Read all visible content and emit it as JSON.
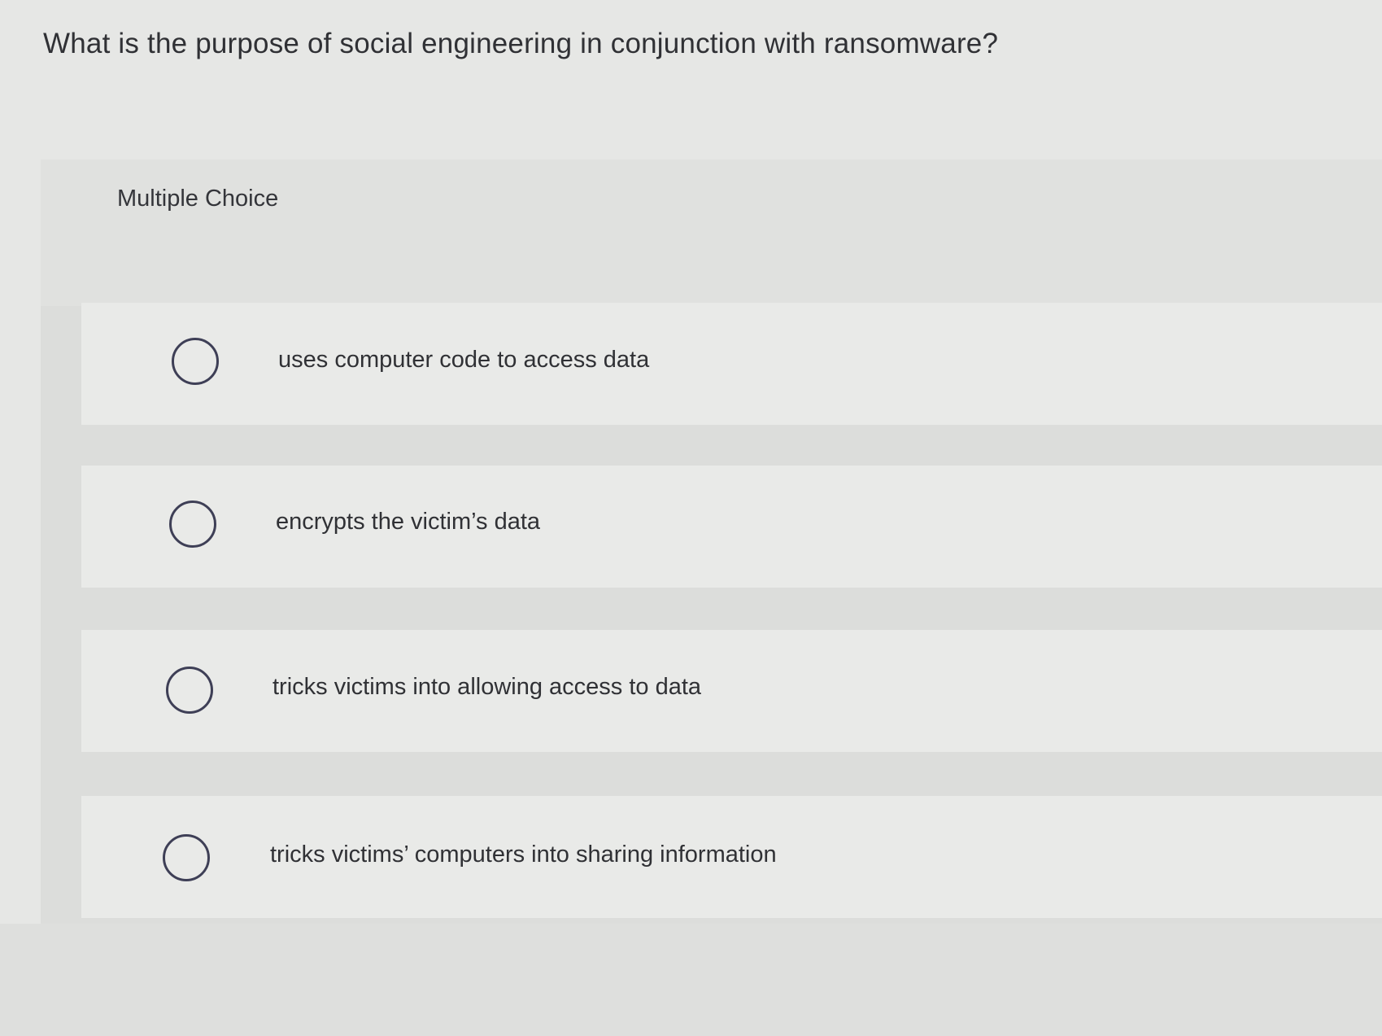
{
  "question": "What is the purpose of social engineering in conjunction with ransomware?",
  "section_label": "Multiple Choice",
  "options": [
    {
      "label": "uses computer code to access data",
      "selected": false
    },
    {
      "label": "encrypts the victim’s data",
      "selected": false
    },
    {
      "label": "tricks victims into allowing access to data",
      "selected": false
    },
    {
      "label": "tricks victims’ computers into sharing information",
      "selected": false
    }
  ],
  "colors": {
    "background": "#e6e7e5",
    "option_row": "#e9eae8",
    "radio_border": "#3e3f56",
    "text": "#303135"
  }
}
